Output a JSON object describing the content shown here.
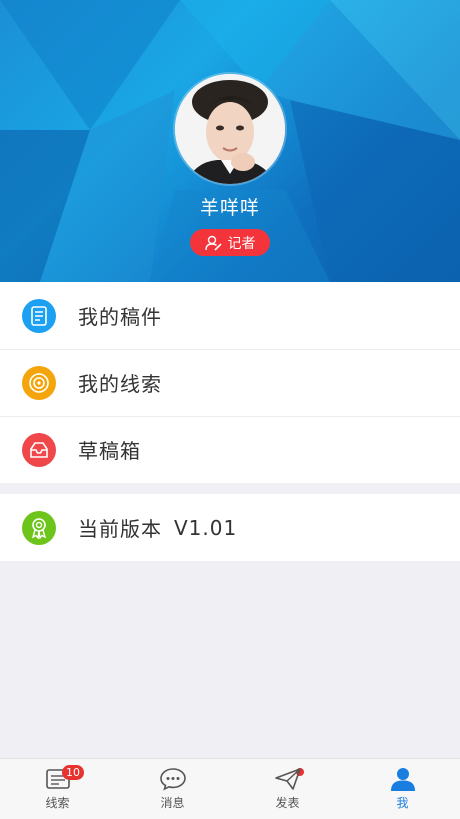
{
  "profile": {
    "name": "羊咩咩",
    "role": "记者"
  },
  "menu": {
    "items": [
      {
        "label": "我的稿件",
        "icon": "document-icon",
        "color": "#1ba0f2"
      },
      {
        "label": "我的线索",
        "icon": "target-icon",
        "color": "#f5a50c"
      },
      {
        "label": "草稿箱",
        "icon": "inbox-icon",
        "color": "#f0474b"
      }
    ],
    "version_label": "当前版本",
    "version_value": "V1.01",
    "version_icon": "award-icon",
    "version_color": "#6dc41a"
  },
  "tabbar": {
    "tabs": [
      {
        "label": "线索",
        "icon": "clues-icon",
        "badge": "10"
      },
      {
        "label": "消息",
        "icon": "message-icon"
      },
      {
        "label": "发表",
        "icon": "send-icon"
      },
      {
        "label": "我",
        "icon": "user-icon",
        "active": true
      }
    ],
    "accent": "#1a7ee0"
  }
}
